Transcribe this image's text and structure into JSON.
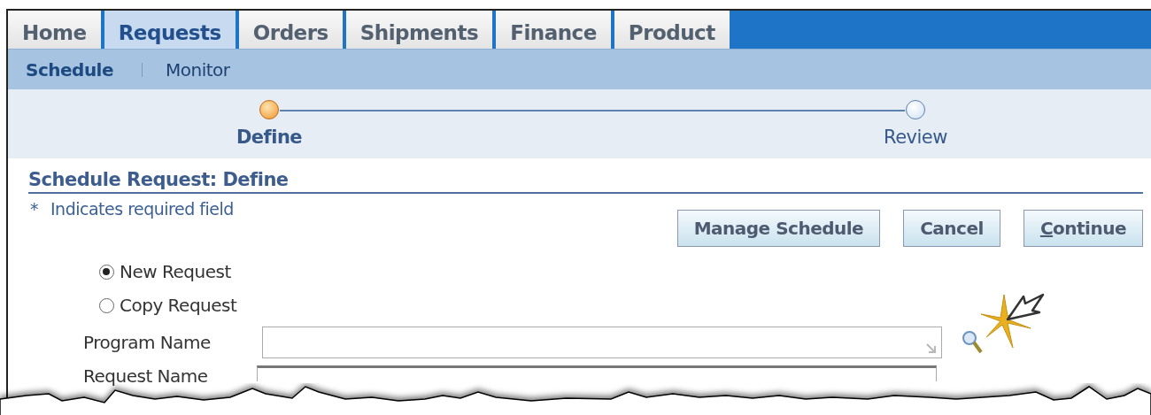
{
  "tabs": [
    {
      "label": "Home",
      "selected": false
    },
    {
      "label": "Requests",
      "selected": true
    },
    {
      "label": "Orders",
      "selected": false
    },
    {
      "label": "Shipments",
      "selected": false
    },
    {
      "label": "Finance",
      "selected": false
    },
    {
      "label": "Product",
      "selected": false
    }
  ],
  "subtabs": [
    {
      "label": "Schedule",
      "selected": true
    },
    {
      "label": "Monitor",
      "selected": false
    }
  ],
  "train": [
    {
      "label": "Define",
      "selected": true
    },
    {
      "label": "Review",
      "selected": false
    }
  ],
  "title": "Schedule Request: Define",
  "required_mark": "*",
  "required_note": "Indicates required field",
  "buttons": [
    {
      "label": "Manage Schedule",
      "access_key_underlined": false
    },
    {
      "label": "Cancel",
      "access_key_underlined": false
    },
    {
      "label": "Continue",
      "access_key_underlined": true
    }
  ],
  "radios": [
    {
      "label": "New Request",
      "selected": true
    },
    {
      "label": "Copy Request",
      "selected": false
    }
  ],
  "fields": [
    {
      "label": "Program Name",
      "kind": "lookup"
    },
    {
      "label": "Request Name",
      "kind": "text"
    }
  ]
}
